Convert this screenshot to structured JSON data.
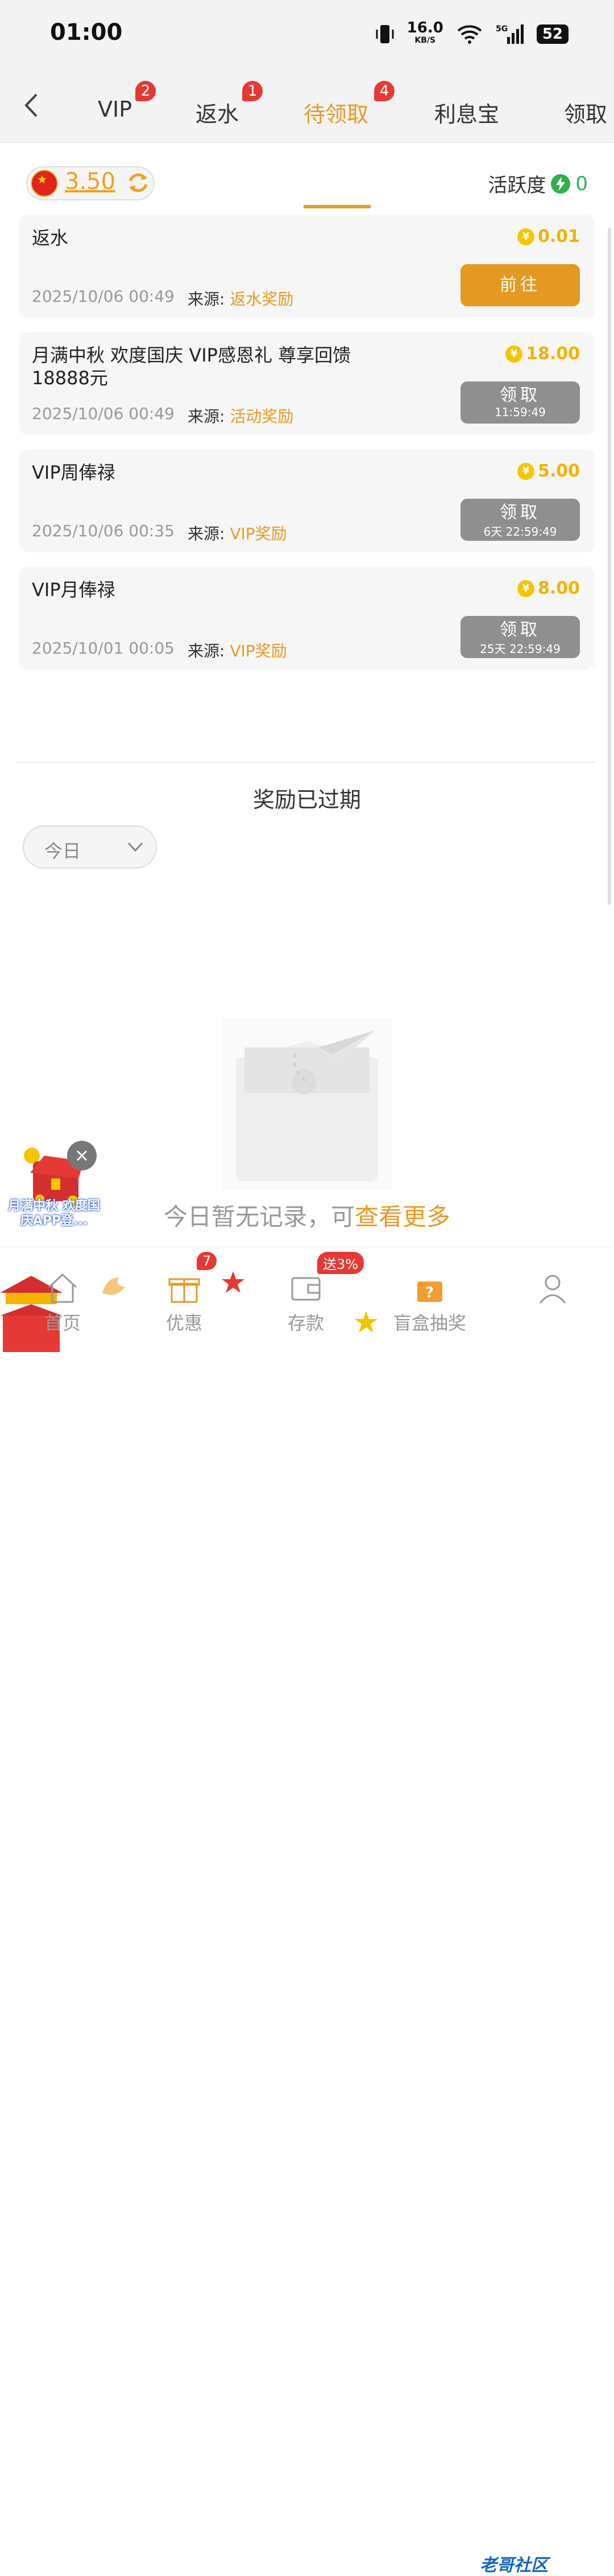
{
  "status_bar": {
    "time": "01:00",
    "speed": "16.0",
    "speed_unit": "KB/S",
    "network": "5G",
    "battery": "52"
  },
  "tabs": [
    {
      "label": "VIP",
      "badge": "2"
    },
    {
      "label": "返水",
      "badge": "1"
    },
    {
      "label": "待领取",
      "badge": "4"
    },
    {
      "label": "利息宝",
      "badge": ""
    },
    {
      "label": "领取",
      "badge": ""
    }
  ],
  "balance": {
    "value": "3.50"
  },
  "activity": {
    "label": "活跃度",
    "value": "0"
  },
  "cards": [
    {
      "title": "返水",
      "amount": "0.01",
      "date": "2025/10/06 00:49",
      "source_label": "来源:",
      "source": "返水奖励",
      "button": "前往",
      "timer": ""
    },
    {
      "title": "月满中秋 欢度国庆 VIP感恩礼  尊享回馈18888元",
      "amount": "18.00",
      "date": "2025/10/06 00:49",
      "source_label": "来源:",
      "source": "活动奖励",
      "button": "领取",
      "timer": "11:59:49"
    },
    {
      "title": "VIP周俸禄",
      "amount": "5.00",
      "date": "2025/10/06 00:35",
      "source_label": "来源:",
      "source": "VIP奖励",
      "button": "领取",
      "timer": "6天 22:59:49"
    },
    {
      "title": "VIP月俸禄",
      "amount": "8.00",
      "date": "2025/10/01 00:05",
      "source_label": "来源:",
      "source": "VIP奖励",
      "button": "领取",
      "timer": "25天 22:59:49"
    }
  ],
  "coin_symbol": "¥",
  "expired": {
    "title": "奖励已过期",
    "filter": "今日"
  },
  "empty": {
    "text": "今日暂无记录，可",
    "link": "查看更多"
  },
  "promo": {
    "text": "月满中秋 欢度国庆APP登...",
    "close": "×"
  },
  "nav": [
    {
      "label": "首页",
      "badge": ""
    },
    {
      "label": "优惠",
      "badge": "7"
    },
    {
      "label": "存款",
      "badge": "送3%"
    },
    {
      "label": "盲盒抽奖",
      "badge": ""
    },
    {
      "label": "",
      "badge": ""
    }
  ],
  "watermark": "老哥社区",
  "colors": {
    "accent": "#e89a22",
    "badge": "#e53935",
    "coin": "#f0b400",
    "activity": "#2eb04b"
  }
}
